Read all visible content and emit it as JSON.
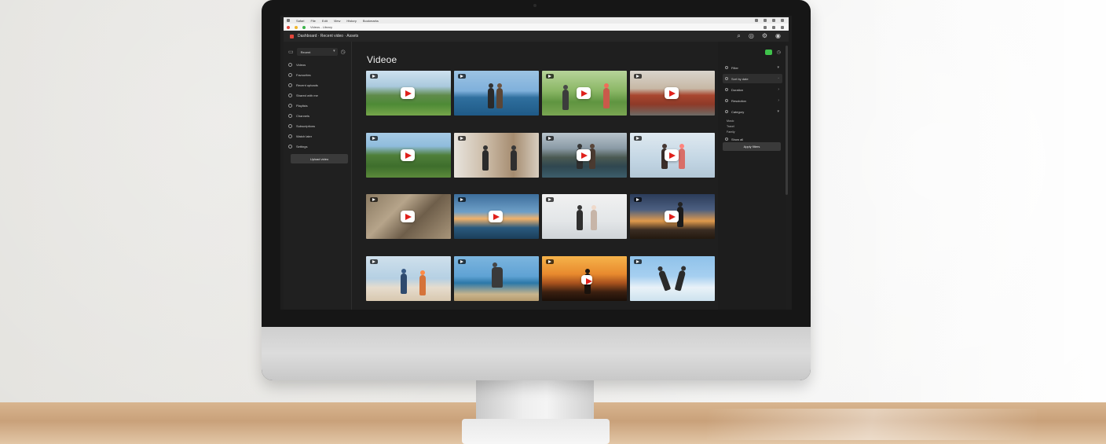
{
  "browser": {
    "menu_items": [
      "Safari",
      "File",
      "Edit",
      "View",
      "History",
      "Bookmarks"
    ],
    "tab_url": "Videos - Library"
  },
  "app": {
    "breadcrumb": "Dashboard · Recent video · Assets"
  },
  "sidebar": {
    "dropdown_label": "Recent",
    "items": [
      {
        "label": "Videos"
      },
      {
        "label": "Favourites"
      },
      {
        "label": "Recent uploads"
      },
      {
        "label": "Shared with me"
      },
      {
        "label": "Playlists"
      },
      {
        "label": "Channels"
      },
      {
        "label": "Subscriptions"
      },
      {
        "label": "Watch later"
      },
      {
        "label": "Settings"
      }
    ],
    "button_label": "Upload video"
  },
  "main": {
    "title": "Videoe",
    "thumbnails": [
      {
        "scene": "green-hills-landscape"
      },
      {
        "scene": "couple-at-sea"
      },
      {
        "scene": "people-in-orchard"
      },
      {
        "scene": "red-food-truck"
      },
      {
        "scene": "forest-valley"
      },
      {
        "scene": "couple-by-window"
      },
      {
        "scene": "mountain-lake"
      },
      {
        "scene": "couple-light-studio"
      },
      {
        "scene": "rocky-portrait"
      },
      {
        "scene": "sunset-pier"
      },
      {
        "scene": "couple-bright-sky"
      },
      {
        "scene": "dusk-rooftop"
      },
      {
        "scene": "beach-walk"
      },
      {
        "scene": "seaside-man"
      },
      {
        "scene": "orange-sunset-silhouette"
      },
      {
        "scene": "beach-jump"
      }
    ]
  },
  "right_panel": {
    "items": [
      {
        "label": "Filter"
      },
      {
        "label": "Sort by date",
        "highlighted": true
      },
      {
        "label": "Duration"
      },
      {
        "label": "Resolution"
      },
      {
        "label": "Category"
      }
    ],
    "sub_items": [
      "Music",
      "Travel",
      "Family"
    ],
    "footer_item": "Show all",
    "button_label": "Apply filters"
  }
}
